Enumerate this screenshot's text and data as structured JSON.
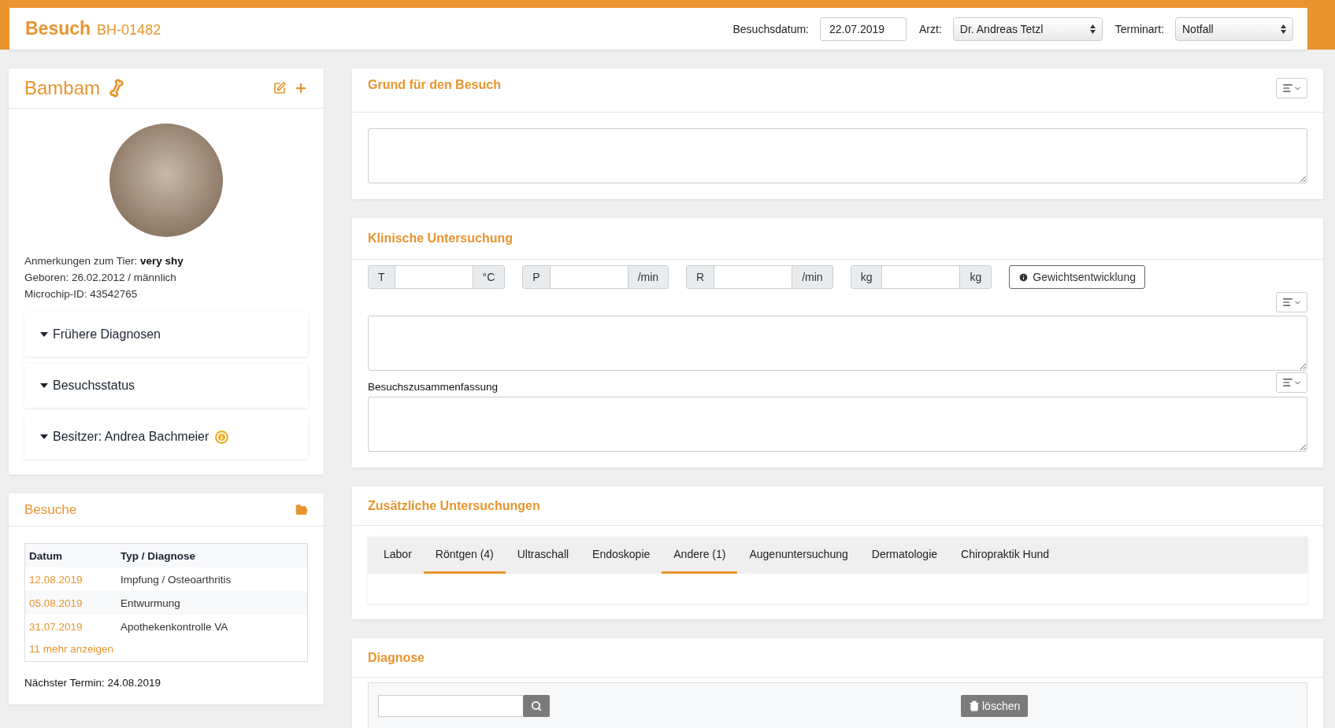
{
  "header": {
    "title": "Besuch",
    "code": "BH-01482",
    "date_label": "Besuchsdatum:",
    "date_value": "22.07.2019",
    "doctor_label": "Arzt:",
    "doctor_value": "Dr. Andreas Tetzl",
    "type_label": "Terminart:",
    "type_value": "Notfall"
  },
  "pet": {
    "name": "Bambam",
    "notes_label": "Anmerkungen zum Tier:",
    "notes_value": "very shy",
    "born": "Geboren: 26.02.2012 / männlich",
    "chip": "Microchip-ID: 43542765",
    "sections": [
      {
        "label": "Frühere Diagnosen",
        "info": false
      },
      {
        "label": "Besuchsstatus",
        "info": false
      },
      {
        "label": "Besitzer: Andrea Bachmeier",
        "info": true
      }
    ]
  },
  "visits": {
    "title": "Besuche",
    "columns": [
      "Datum",
      "Typ / Diagnose"
    ],
    "rows": [
      {
        "date": "12.08.2019",
        "type": "Impfung / Osteoarthritis"
      },
      {
        "date": "05.08.2019",
        "type": "Entwurmung"
      },
      {
        "date": "31.07.2019",
        "type": "Apothekenkontrolle VA"
      }
    ],
    "more": "11 mehr anzeigen",
    "next": "Nächster Termin: 24.08.2019"
  },
  "reason": {
    "title": "Grund für den Besuch"
  },
  "clinical": {
    "title": "Klinische Untersuchung",
    "vitals": [
      {
        "prefix": "T",
        "suffix": "°C"
      },
      {
        "prefix": "P",
        "suffix": "/min"
      },
      {
        "prefix": "R",
        "suffix": "/min"
      },
      {
        "prefix": "kg",
        "suffix": "kg"
      }
    ],
    "weight_button": "Gewichtsentwicklung",
    "summary_label": "Besuchszusammenfassung"
  },
  "extra": {
    "title": "Zusätzliche Untersuchungen",
    "tabs": [
      {
        "label": "Labor",
        "marked": false
      },
      {
        "label": "Röntgen (4)",
        "marked": true
      },
      {
        "label": "Ultraschall",
        "marked": false
      },
      {
        "label": "Endoskopie",
        "marked": false
      },
      {
        "label": "Andere (1)",
        "marked": true
      },
      {
        "label": "Augenuntersuchung",
        "marked": false
      },
      {
        "label": "Dermatologie",
        "marked": false
      },
      {
        "label": "Chiropraktik Hund",
        "marked": false
      }
    ]
  },
  "diagnosis": {
    "title": "Diagnose",
    "delete_button": "löschen"
  }
}
